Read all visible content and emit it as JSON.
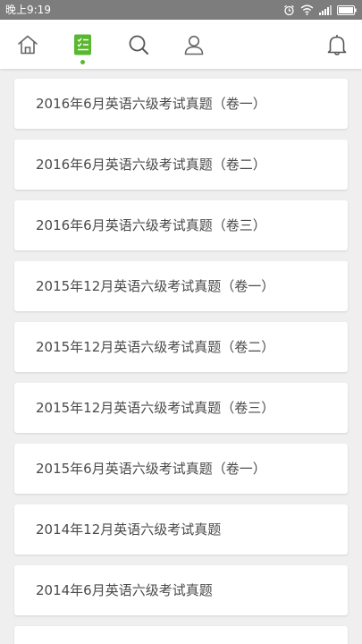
{
  "status_bar": {
    "time": "晚上9:19",
    "icons": [
      "alarm-icon",
      "wifi-icon",
      "signal-icon",
      "battery-icon"
    ]
  },
  "nav": {
    "items": [
      {
        "icon": "home-icon",
        "active": false
      },
      {
        "icon": "list-icon",
        "active": true
      },
      {
        "icon": "search-icon",
        "active": false
      },
      {
        "icon": "user-icon",
        "active": false
      },
      {
        "icon": "bell-icon",
        "active": false
      }
    ],
    "accent_color": "#5ab830"
  },
  "exams": [
    {
      "title": "2016年6月英语六级考试真题（卷一）"
    },
    {
      "title": "2016年6月英语六级考试真题（卷二）"
    },
    {
      "title": "2016年6月英语六级考试真题（卷三）"
    },
    {
      "title": "2015年12月英语六级考试真题（卷一）"
    },
    {
      "title": "2015年12月英语六级考试真题（卷二）"
    },
    {
      "title": "2015年12月英语六级考试真题（卷三）"
    },
    {
      "title": "2015年6月英语六级考试真题（卷一）"
    },
    {
      "title": "2014年12月英语六级考试真题"
    },
    {
      "title": "2014年6月英语六级考试真题"
    },
    {
      "title": ""
    }
  ]
}
